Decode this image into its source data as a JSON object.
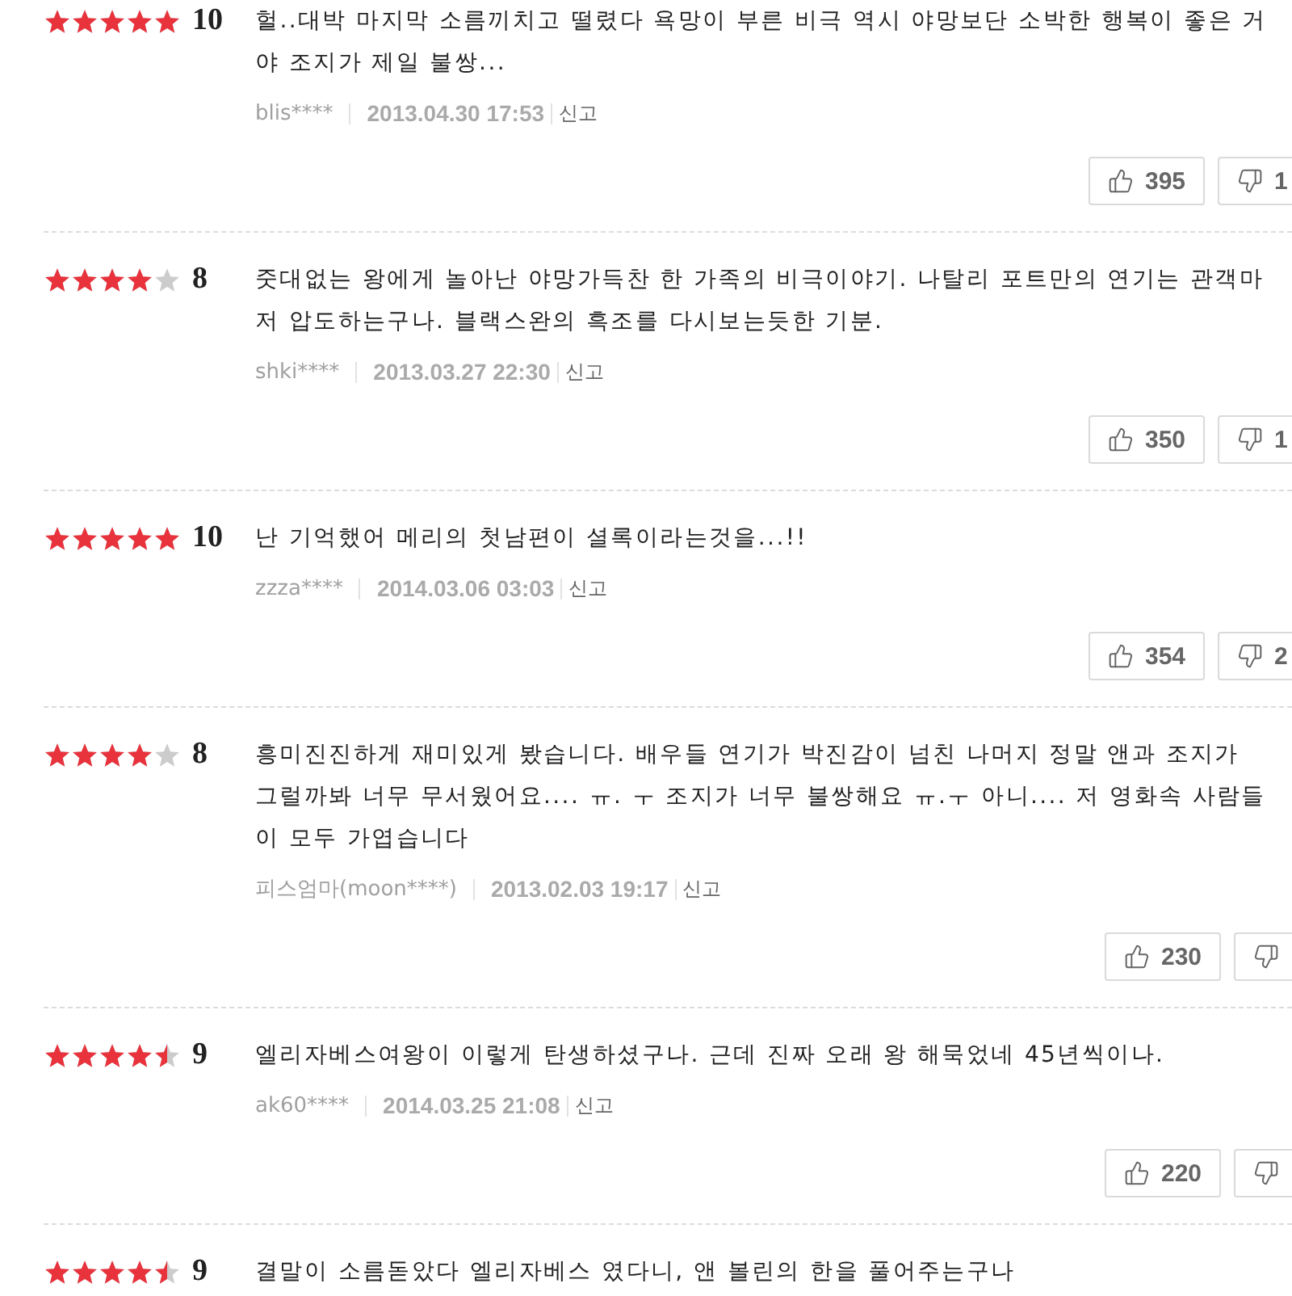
{
  "reviews": [
    {
      "stars": 5,
      "score": "10",
      "text": "헐..대박 마지막 소름끼치고 떨렸다 욕망이 부른 비극 역시 야망보단 소박한 행복이 좋은 거야 조지가 제일 불쌍...",
      "author": "blis****",
      "date": "2013.04.30 17:53",
      "report": "신고",
      "likes": "395",
      "dislikes": "1"
    },
    {
      "stars": 4,
      "score": "8",
      "text": "줏대없는 왕에게 놀아난 야망가득찬 한 가족의 비극이야기. 나탈리 포트만의 연기는 관객마저 압도하는구나. 블랙스완의 흑조를 다시보는듯한 기분.",
      "author": "shki****",
      "date": "2013.03.27 22:30",
      "report": "신고",
      "likes": "350",
      "dislikes": "1"
    },
    {
      "stars": 5,
      "score": "10",
      "text": "난 기억했어 메리의 첫남편이 셜록이라는것을...!!",
      "author": "zzza****",
      "date": "2014.03.06 03:03",
      "report": "신고",
      "likes": "354",
      "dislikes": "2"
    },
    {
      "stars": 4,
      "score": "8",
      "text": "흥미진진하게 재미있게 봤습니다. 배우들 연기가 박진감이 넘친 나머지 정말 앤과 조지가 그럴까봐 너무 무서웠어요.... ㅠ. ㅜ 조지가 너무 불쌍해요 ㅠ.ㅜ 아니.... 저 영화속 사람들이 모두 가엽습니다",
      "author": "피스엄마(moon****)",
      "date": "2013.02.03 19:17",
      "report": "신고",
      "likes": "230"
    },
    {
      "stars": 4.5,
      "score": "9",
      "text": "엘리자베스여왕이 이렇게 탄생하셨구나. 근데 진짜 오래 왕 해묵었네 45년씩이나.",
      "author": "ak60****",
      "date": "2014.03.25 21:08",
      "report": "신고",
      "likes": "220"
    },
    {
      "stars": 4.5,
      "score": "9",
      "text": "결말이 소름돋았다 엘리자베스 였다니, 앤 볼린의 한을 풀어주는구나"
    }
  ]
}
